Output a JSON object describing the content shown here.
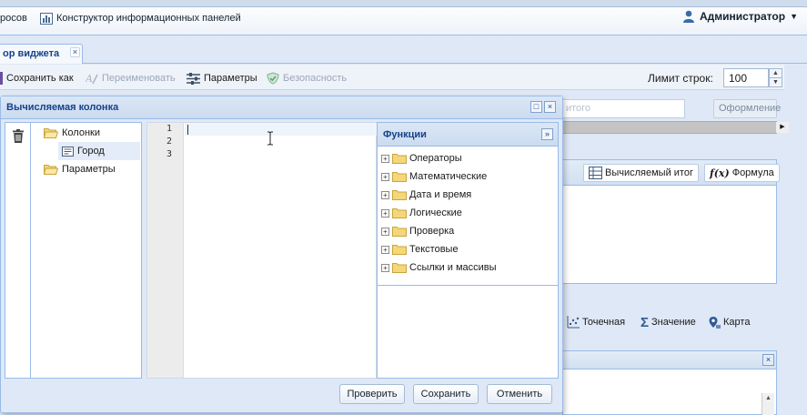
{
  "topbar": {
    "menu": [
      {
        "label": "росов"
      },
      {
        "label": "Конструктор информационных панелей"
      }
    ],
    "user": "Администратор"
  },
  "page_tab": {
    "label": "ор виджета"
  },
  "toolbar": {
    "save_as": "Сохранить как",
    "rename": "Переименовать",
    "params": "Параметры",
    "security": "Безопасность",
    "row_limit_label": "Лимит строк:",
    "row_limit_value": "100"
  },
  "right": {
    "search_placeholder": "итого",
    "format_button": "Оформление",
    "calc_total": "Вычисляемый итог",
    "formula": "Формула",
    "point": "Точечная",
    "value": "Значение",
    "map": "Карта"
  },
  "modal": {
    "title": "Вычисляемая колонка",
    "tree": {
      "columns": "Колонки",
      "city": "Город",
      "params": "Параметры"
    },
    "editor": {
      "lines": [
        "1",
        "2",
        "3"
      ]
    },
    "functions": {
      "title": "Функции",
      "items": [
        "Операторы",
        "Математические",
        "Дата и время",
        "Логические",
        "Проверка",
        "Текстовые",
        "Ссылки и массивы"
      ]
    },
    "buttons": {
      "check": "Проверить",
      "save": "Сохранить",
      "cancel": "Отменить"
    }
  }
}
